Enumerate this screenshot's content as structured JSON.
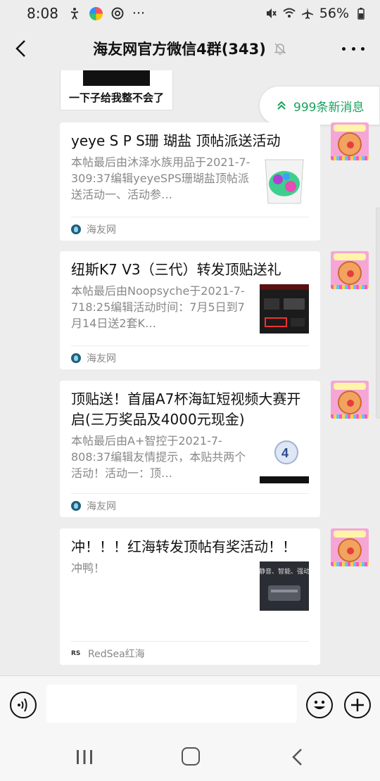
{
  "status_bar": {
    "time": "8:08",
    "more_indicator": "···",
    "battery": "56%",
    "icons_left": [
      "accessibility-icon",
      "app-notification-icon",
      "at-notification-icon"
    ],
    "icons_right": [
      "mute-icon",
      "wifi-icon",
      "airplane-icon",
      "battery-icon"
    ]
  },
  "header": {
    "title": "海友网官方微信4群(343)",
    "muted": true
  },
  "previous_message": {
    "caption": "一下子给我整不会了"
  },
  "new_messages": {
    "label": "999条新消息"
  },
  "messages": [
    {
      "title": "yeye S P S珊 瑚盐 顶帖派送活动",
      "description": "本帖最后由沐泽水族用品于2021-7-309:37编辑yeyeSPS珊瑚盐顶帖派送活动一、活动参…",
      "source": "海友网",
      "thumb": "salt-bucket-thumbnail"
    },
    {
      "title": "纽斯K7 V3（三代）转发顶贴送礼",
      "description": "本帖最后由Noopsyche于2021-7-718:25编辑活动时间：7月5日到7月14日送2套K…",
      "source": "海友网",
      "thumb": "k7-device-thumbnail"
    },
    {
      "title": "顶贴送！首届A7杯海缸短视频大赛开启(三万奖品及4000元现金)",
      "description": "本帖最后由A+智控于2021-7-808:37编辑友情提示，本贴共两个活动！活动一：顶…",
      "source": "海友网",
      "thumb": "a7-logo-thumbnail"
    },
    {
      "title": "冲！！！红海转发顶帖有奖活动！！",
      "description": "冲鸭！",
      "source": "RedSea红海",
      "thumb_text": "静音、智能、强动",
      "thumb": "redsea-product-thumbnail"
    }
  ],
  "input_bar": {
    "value": "",
    "placeholder": ""
  },
  "colors": {
    "background": "#ededed",
    "card": "#ffffff",
    "accent_green": "#1aa260",
    "secondary_text": "#888888"
  }
}
